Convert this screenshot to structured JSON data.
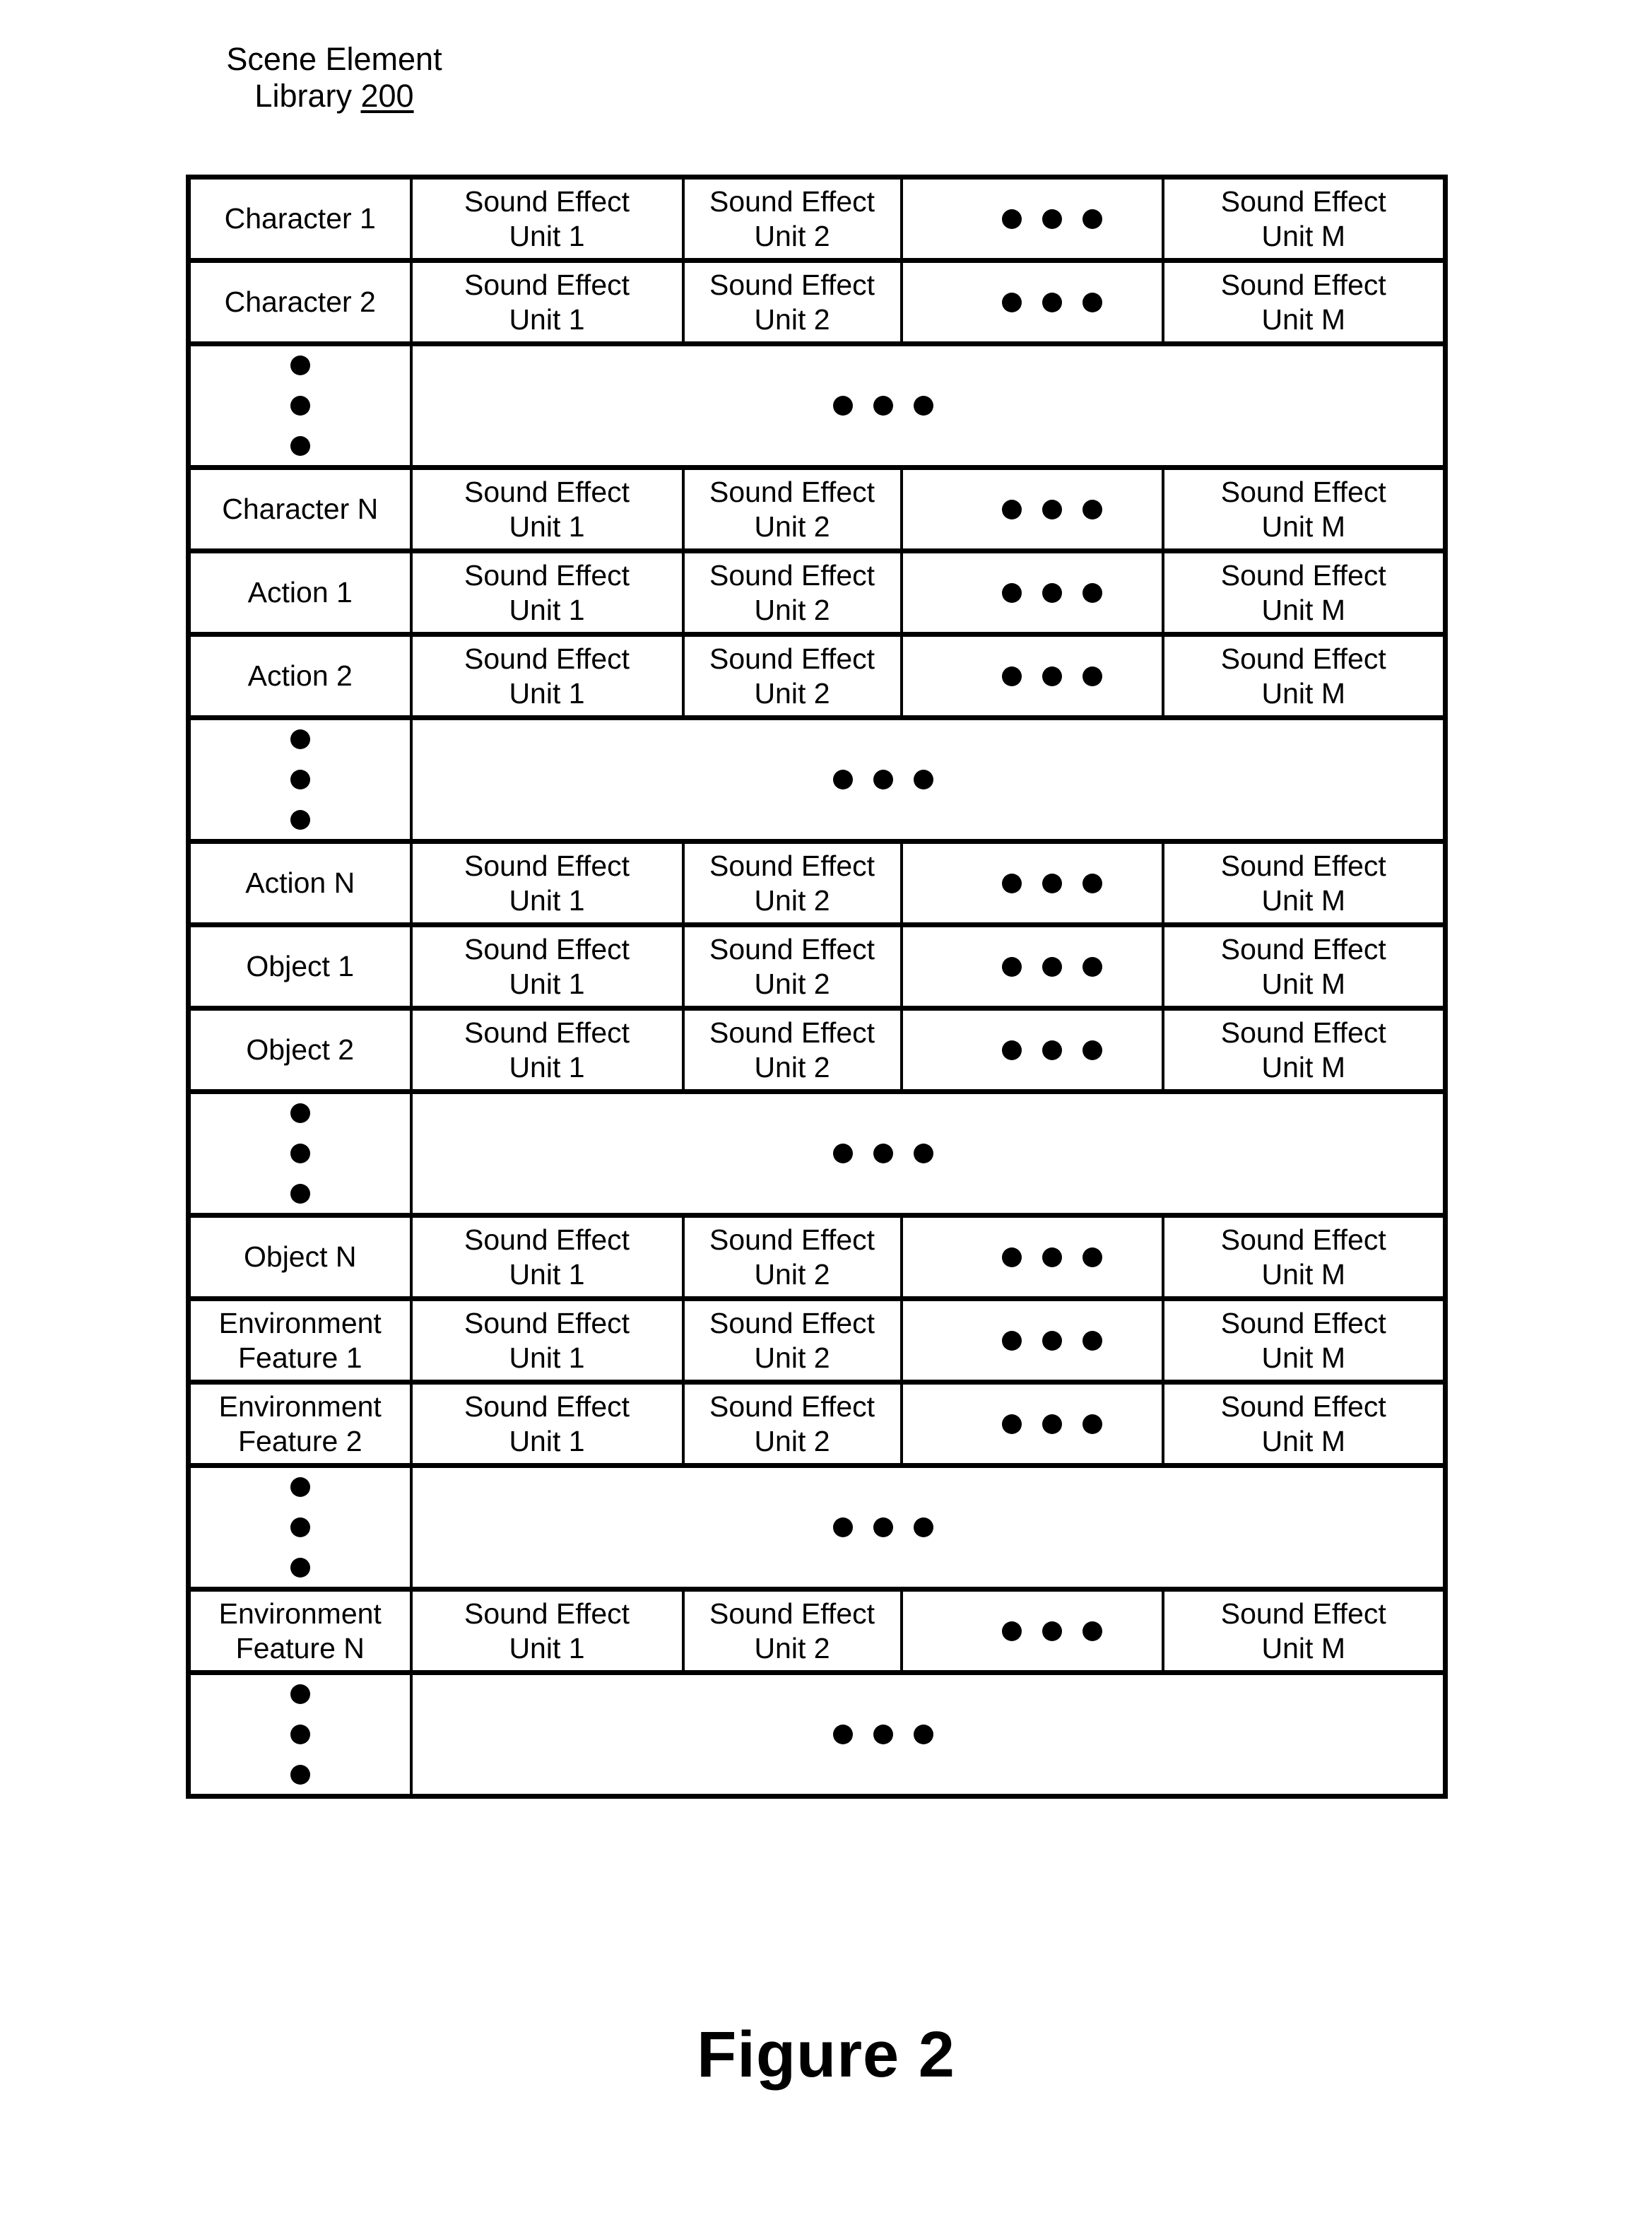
{
  "figure": {
    "title_line_1": "Scene Element",
    "title_line_2": "Library ",
    "reference_number": "200",
    "caption": "Figure 2"
  },
  "table": {
    "columns": [
      {
        "key": "label",
        "header": ""
      },
      {
        "key": "unit_1",
        "header": ""
      },
      {
        "key": "unit_2",
        "header": ""
      },
      {
        "key": "more",
        "header": ""
      },
      {
        "key": "unit_m",
        "header": ""
      }
    ],
    "cell_values": {
      "sound_effect_unit_1": "Sound Effect\nUnit 1",
      "sound_effect_unit_2": "Sound Effect\nUnit 2",
      "sound_effect_unit_m": "Sound Effect\nUnit M"
    },
    "rows": [
      {
        "type": "data",
        "label": "Character 1"
      },
      {
        "type": "data",
        "label": "Character 2"
      },
      {
        "type": "ellipsis",
        "label": ""
      },
      {
        "type": "data",
        "label": "Character N"
      },
      {
        "type": "data",
        "label": "Action 1"
      },
      {
        "type": "data",
        "label": "Action 2"
      },
      {
        "type": "ellipsis",
        "label": ""
      },
      {
        "type": "data",
        "label": "Action N"
      },
      {
        "type": "data",
        "label": "Object 1"
      },
      {
        "type": "data",
        "label": "Object 2"
      },
      {
        "type": "ellipsis",
        "label": ""
      },
      {
        "type": "data",
        "label": "Object N"
      },
      {
        "type": "data",
        "label": "Environment\nFeature 1"
      },
      {
        "type": "data",
        "label": "Environment\nFeature 2"
      },
      {
        "type": "ellipsis",
        "label": ""
      },
      {
        "type": "data",
        "label": "Environment\nFeature N"
      },
      {
        "type": "ellipsis",
        "label": ""
      }
    ]
  },
  "colors": {
    "line": "#000000",
    "background": "#ffffff",
    "text": "#000000"
  }
}
